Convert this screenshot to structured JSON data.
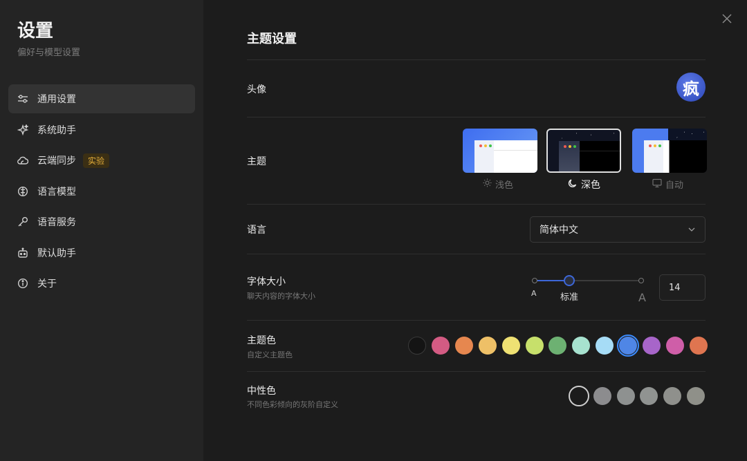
{
  "sidebar": {
    "title": "设置",
    "subtitle": "偏好与模型设置",
    "items": [
      {
        "label": "通用设置",
        "icon": "sliders-icon",
        "active": true
      },
      {
        "label": "系统助手",
        "icon": "sparkle-icon"
      },
      {
        "label": "云端同步",
        "icon": "cloud-icon",
        "badge": "实验"
      },
      {
        "label": "语言模型",
        "icon": "brain-icon"
      },
      {
        "label": "语音服务",
        "icon": "key-icon"
      },
      {
        "label": "默认助手",
        "icon": "robot-icon"
      },
      {
        "label": "关于",
        "icon": "info-icon"
      }
    ]
  },
  "main": {
    "title": "主题设置",
    "avatar": {
      "label": "头像",
      "char": "疯"
    },
    "theme": {
      "label": "主题",
      "selected": "深色",
      "options": [
        {
          "label": "浅色",
          "icon": "sun-icon"
        },
        {
          "label": "深色",
          "icon": "moon-icon"
        },
        {
          "label": "自动",
          "icon": "monitor-icon"
        }
      ]
    },
    "language": {
      "label": "语言",
      "value": "简体中文"
    },
    "font_size": {
      "label": "字体大小",
      "desc": "聊天内容的字体大小",
      "small_marker": "A",
      "large_marker": "A",
      "preset_label": "标准",
      "value": "14",
      "slider_level": 0.33
    },
    "theme_color": {
      "label": "主题色",
      "desc": "自定义主题色",
      "colors": [
        "#141414",
        "#d35b83",
        "#e6874f",
        "#eec067",
        "#efe173",
        "#c7e06b",
        "#6db172",
        "#a7e2cf",
        "#a6dcf6",
        "#4f86e6",
        "#a765c9",
        "#cf5ea8",
        "#df7550"
      ],
      "selected_index": 9
    },
    "neutral_color": {
      "label": "中性色",
      "desc": "不同色彩倾向的灰阶自定义",
      "colors": [
        "#1c1c1c",
        "#8c8c8e",
        "#8e9190",
        "#909391",
        "#8f908c",
        "#8f9089"
      ],
      "selected_index": 0
    }
  }
}
